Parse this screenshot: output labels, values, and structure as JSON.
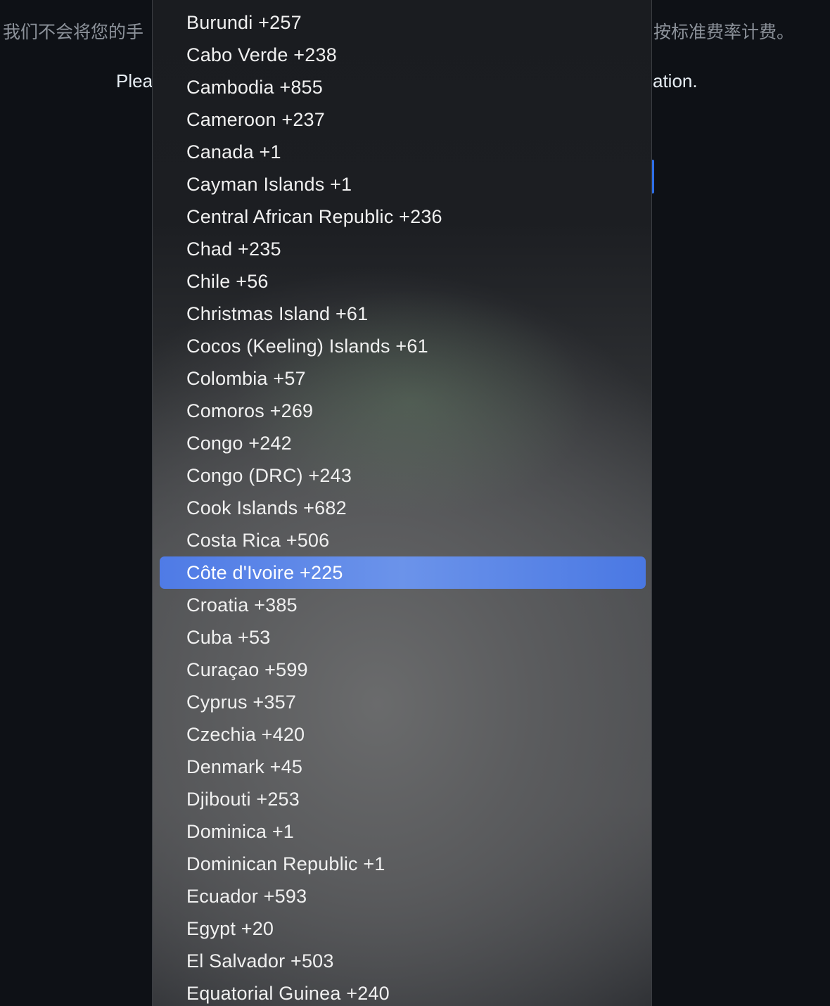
{
  "background": {
    "notice_left": "我们不会将您的手",
    "notice_right": "按标准费率计费。",
    "please_left": "Plea",
    "please_right": "ation."
  },
  "country_dropdown": {
    "selected_index": 17,
    "accent_color": "#5a85e8",
    "options": [
      "Burundi +257",
      "Cabo Verde +238",
      "Cambodia +855",
      "Cameroon +237",
      "Canada +1",
      "Cayman Islands +1",
      "Central African Republic +236",
      "Chad +235",
      "Chile +56",
      "Christmas Island +61",
      "Cocos (Keeling) Islands +61",
      "Colombia +57",
      "Comoros +269",
      "Congo +242",
      "Congo (DRC) +243",
      "Cook Islands +682",
      "Costa Rica +506",
      "Côte d'Ivoire +225",
      "Croatia +385",
      "Cuba +53",
      "Curaçao +599",
      "Cyprus +357",
      "Czechia +420",
      "Denmark +45",
      "Djibouti +253",
      "Dominica +1",
      "Dominican Republic +1",
      "Ecuador +593",
      "Egypt +20",
      "El Salvador +503",
      "Equatorial Guinea +240"
    ]
  }
}
